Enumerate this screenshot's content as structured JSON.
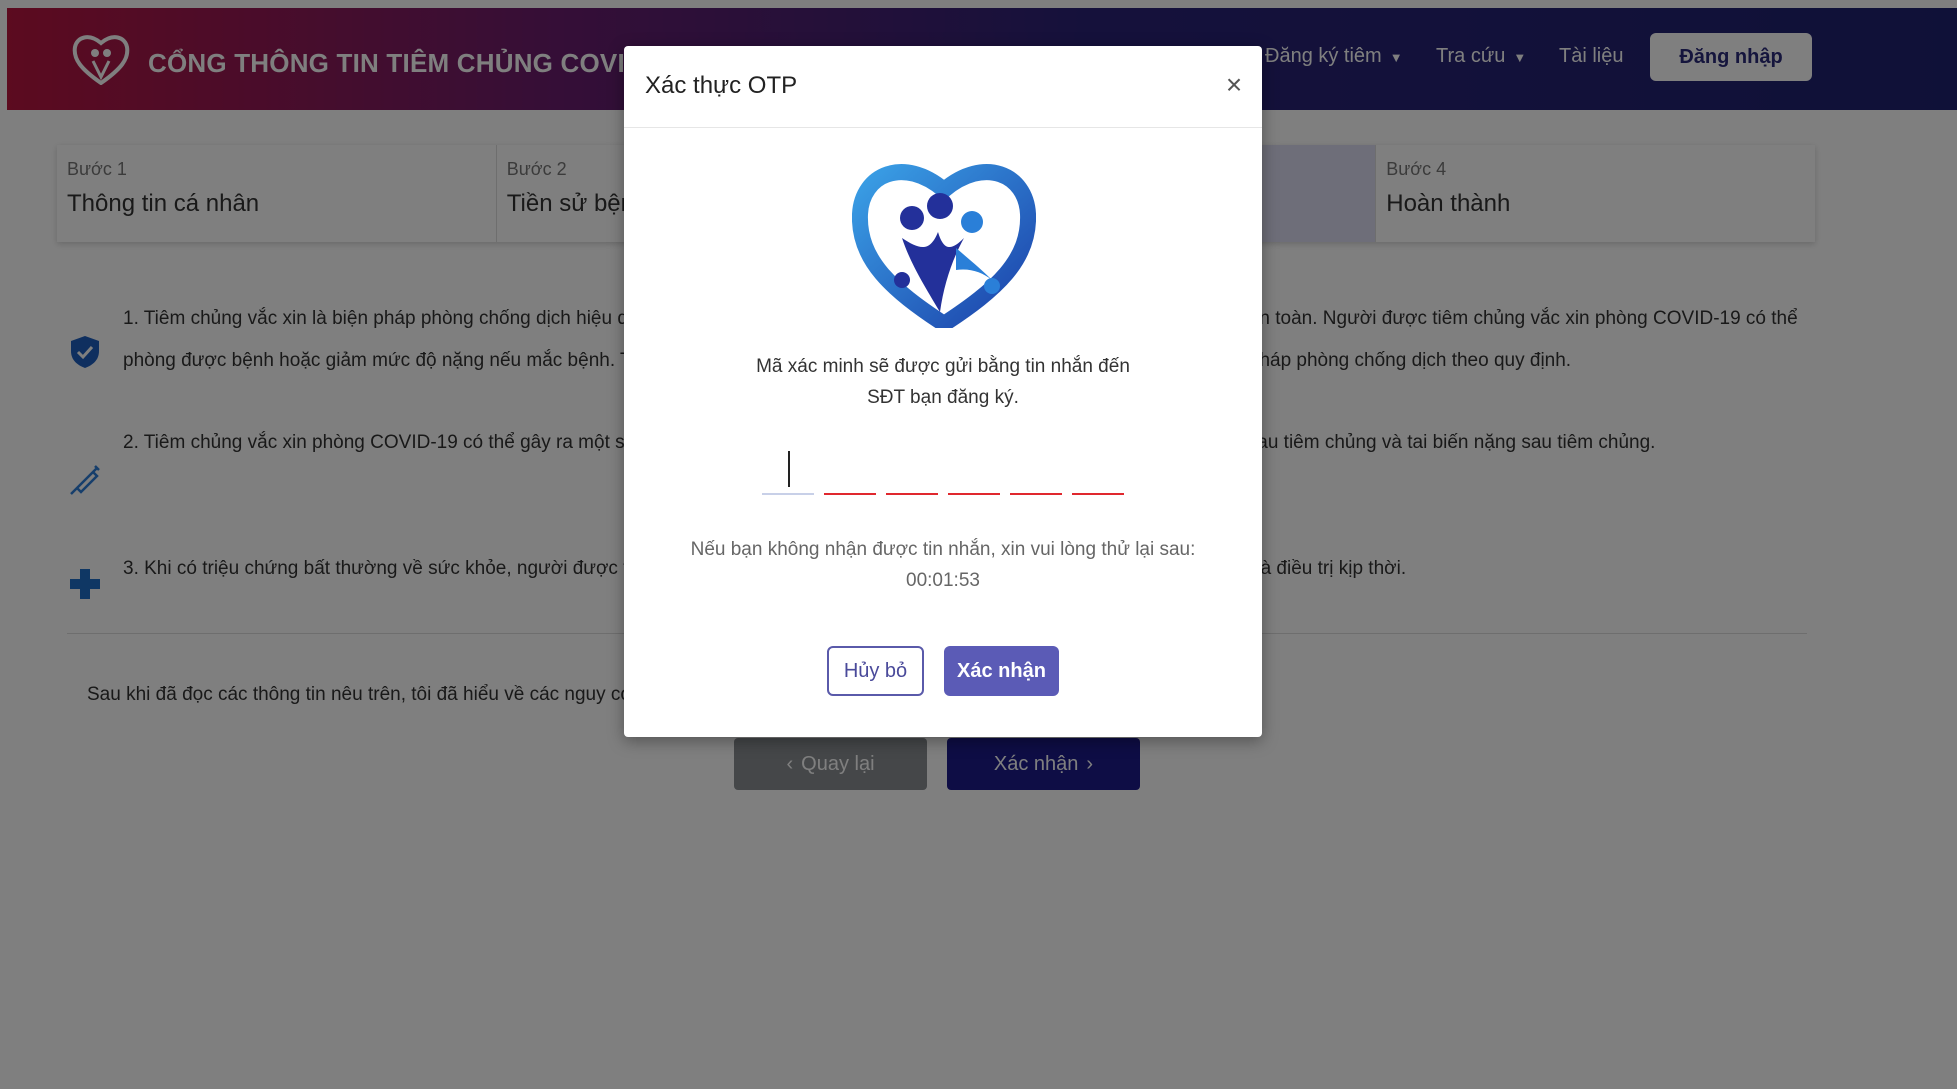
{
  "header": {
    "title": "CỔNG THÔNG TIN TIÊM CHỦNG COVID-19",
    "nav": [
      {
        "label": "Đăng ký tiêm"
      },
      {
        "label": "Tra cứu"
      },
      {
        "label": "Tài liệu"
      }
    ],
    "login_label": "Đăng nhập"
  },
  "steps": [
    {
      "num": "Bước 1",
      "title": "Thông tin cá nhân"
    },
    {
      "num": "Bước 2",
      "title": "Tiền sử bệnh"
    },
    {
      "num": "",
      "title": ""
    },
    {
      "num": "Bước 4",
      "title": "Hoàn thành"
    }
  ],
  "content": {
    "items": [
      {
        "icon": "shield-check-icon",
        "text": "1. Tiêm chủng vắc xin là biện pháp phòng chống dịch hiệu quả, tuy nhiên vắc xin phòng COVID-19 có thể không phòng được bệnh hoàn toàn. Người được tiêm chủng vắc xin phòng COVID-19 có thể phòng được bệnh hoặc giảm mức độ nặng nếu mắc bệnh. Tuy nhiên, sau khi tiêm chủng vẫn phải tiếp tục thực hiện nghiêm các biện pháp phòng chống dịch theo quy định."
      },
      {
        "icon": "syringe-icon",
        "text": "2. Tiêm chủng vắc xin phòng COVID-19 có thể gây ra một số biểu hiện tại chỗ tiêm hoặc toàn thân, bao gồm phản ứng thông thường sau tiêm chủng và tai biến nặng sau tiêm chủng."
      },
      {
        "icon": "medical-cross-icon",
        "text": "3. Khi có triệu chứng bất thường về sức khỏe, người được tiêm chủng cần đến ngay cơ sở y tế gần nhất để được tư vấn, thăm khám và điều trị kịp thời."
      }
    ],
    "confirm_text": "Sau khi đã đọc các thông tin nêu trên, tôi đã hiểu về các nguy cơ và đồng ý tiêm chủng vắc xin phòng COVID-19.",
    "back_label": "Quay lại",
    "next_label": "Xác nhận"
  },
  "modal": {
    "title": "Xác thực OTP",
    "close_glyph": "×",
    "message_line1": "Mã xác minh sẽ được gửi bằng tin nhắn đến",
    "message_line2": "SĐT bạn đăng ký.",
    "otp_values": [
      "",
      "",
      "",
      "",
      "",
      ""
    ],
    "resend_text": "Nếu bạn không nhận được tin nhắn, xin vui lòng thử lại sau:",
    "countdown": "00:01:53",
    "cancel_label": "Hủy bỏ",
    "confirm_label": "Xác nhận"
  },
  "colors": {
    "header_start": "#b8163f",
    "header_end": "#1f2270",
    "primary": "#1c1a8a",
    "modal_button": "#5b5bb6",
    "otp_underline": "#e0282e"
  }
}
